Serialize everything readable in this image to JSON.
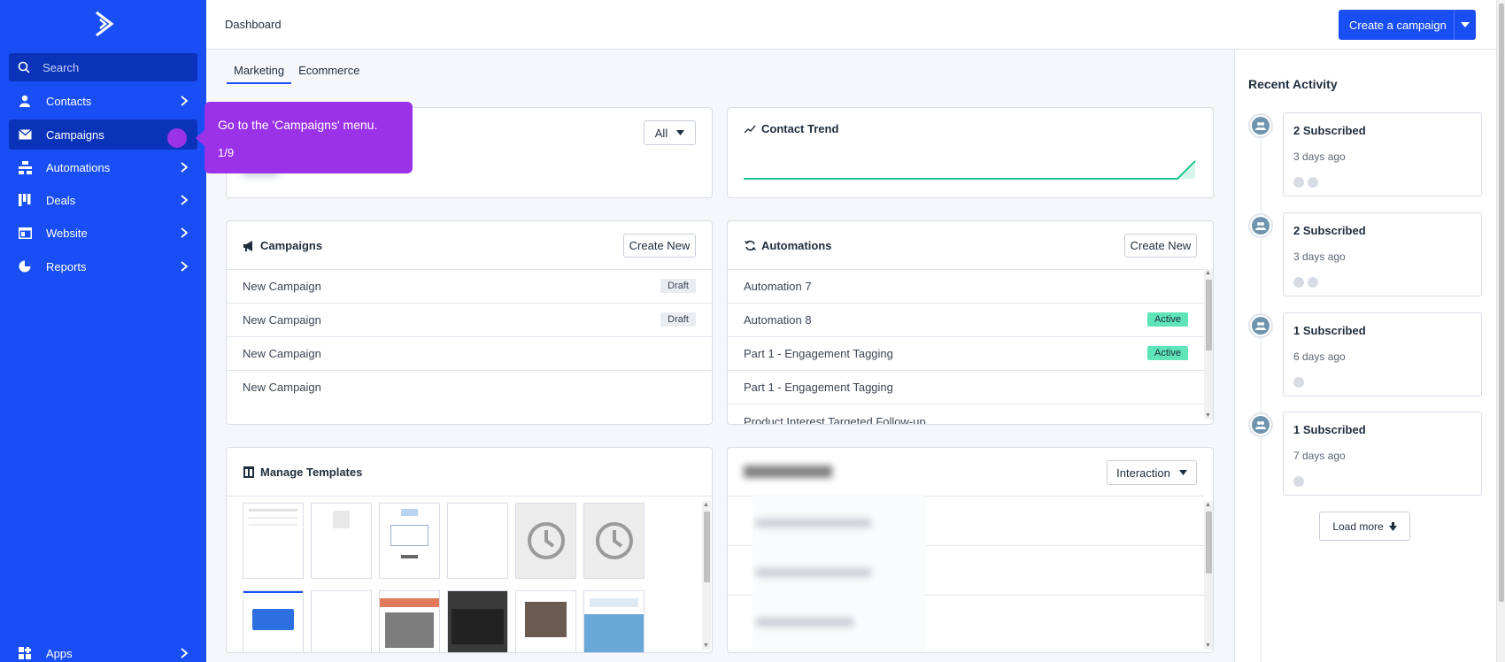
{
  "sidebar": {
    "search_placeholder": "Search",
    "items": [
      {
        "label": "Contacts",
        "icon": "person-icon"
      },
      {
        "label": "Campaigns",
        "icon": "envelope-icon"
      },
      {
        "label": "Automations",
        "icon": "automation-icon"
      },
      {
        "label": "Deals",
        "icon": "deals-icon"
      },
      {
        "label": "Website",
        "icon": "website-icon"
      },
      {
        "label": "Reports",
        "icon": "pie-chart-icon"
      }
    ],
    "apps_label": "Apps"
  },
  "header": {
    "title": "Dashboard",
    "cta_label": "Create a campaign"
  },
  "tabs": [
    "Marketing",
    "Ecommerce"
  ],
  "filter_card": {
    "select_value": "All"
  },
  "contact_trend": {
    "title": "Contact Trend"
  },
  "campaigns": {
    "title": "Campaigns",
    "create_label": "Create New",
    "rows": [
      {
        "name": "New Campaign",
        "status": "Draft"
      },
      {
        "name": "New Campaign",
        "status": "Draft"
      },
      {
        "name": "New Campaign",
        "status": ""
      },
      {
        "name": "New Campaign",
        "status": ""
      }
    ]
  },
  "automations": {
    "title": "Automations",
    "create_label": "Create New",
    "rows": [
      {
        "name": "Automation 7",
        "status": ""
      },
      {
        "name": "Automation 8",
        "status": "Active"
      },
      {
        "name": "Part 1 - Engagement Tagging",
        "status": "Active"
      },
      {
        "name": "Part 1 - Engagement Tagging",
        "status": ""
      },
      {
        "name": "Product Interest Targeted Follow-up",
        "status": ""
      }
    ]
  },
  "templates": {
    "title": "Manage Templates"
  },
  "contacts_card": {
    "select_value": "Interaction"
  },
  "tooltip": {
    "text": "Go to the 'Campaigns' menu.",
    "step": "1/9"
  },
  "recent_activity": {
    "title": "Recent Activity",
    "items": [
      {
        "head": "2 Subscribed",
        "time": "3 days ago",
        "people": 2
      },
      {
        "head": "2 Subscribed",
        "time": "3 days ago",
        "people": 2
      },
      {
        "head": "1 Subscribed",
        "time": "6 days ago",
        "people": 1
      },
      {
        "head": "1 Subscribed",
        "time": "7 days ago",
        "people": 1
      }
    ],
    "load_more_label": "Load more"
  },
  "colors": {
    "brand": "#1a4ef5",
    "sidebar_active": "#0b33b9",
    "tooltip": "#9b32e8",
    "active_badge": "#5fe4b9",
    "trend_line": "#1cc592"
  }
}
